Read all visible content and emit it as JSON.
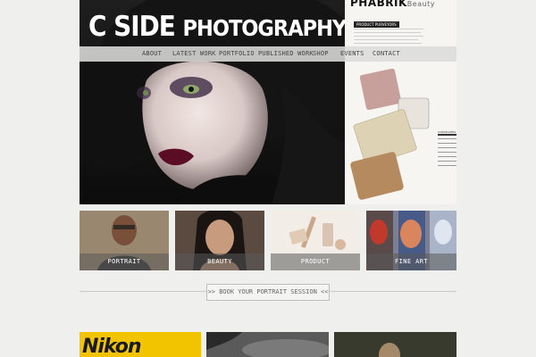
{
  "brand": {
    "logo_text": "C SIDE",
    "logo_rest": "PHOTOGRAPHY"
  },
  "nav": {
    "items": [
      "ABOUT",
      "LATEST WORK",
      "PORTFOLIO",
      "PUBLISHED WORK",
      "SHOP",
      "EVENTS",
      "CONTACT"
    ]
  },
  "magazine": {
    "brand": "PHABRIK",
    "brand_sub": "Beauty",
    "section_label": "PRODUCT PURVEYORS",
    "side_label": "CONCEALERS"
  },
  "categories": [
    {
      "label": "PORTRAIT"
    },
    {
      "label": "BEAUTY"
    },
    {
      "label": "PRODUCT"
    },
    {
      "label": "FINE ART"
    }
  ],
  "cta": {
    "book_label": ">> BOOK YOUR PORTRAIT SESSION <<"
  },
  "bottom": {
    "nikon_text": "Nikon"
  }
}
